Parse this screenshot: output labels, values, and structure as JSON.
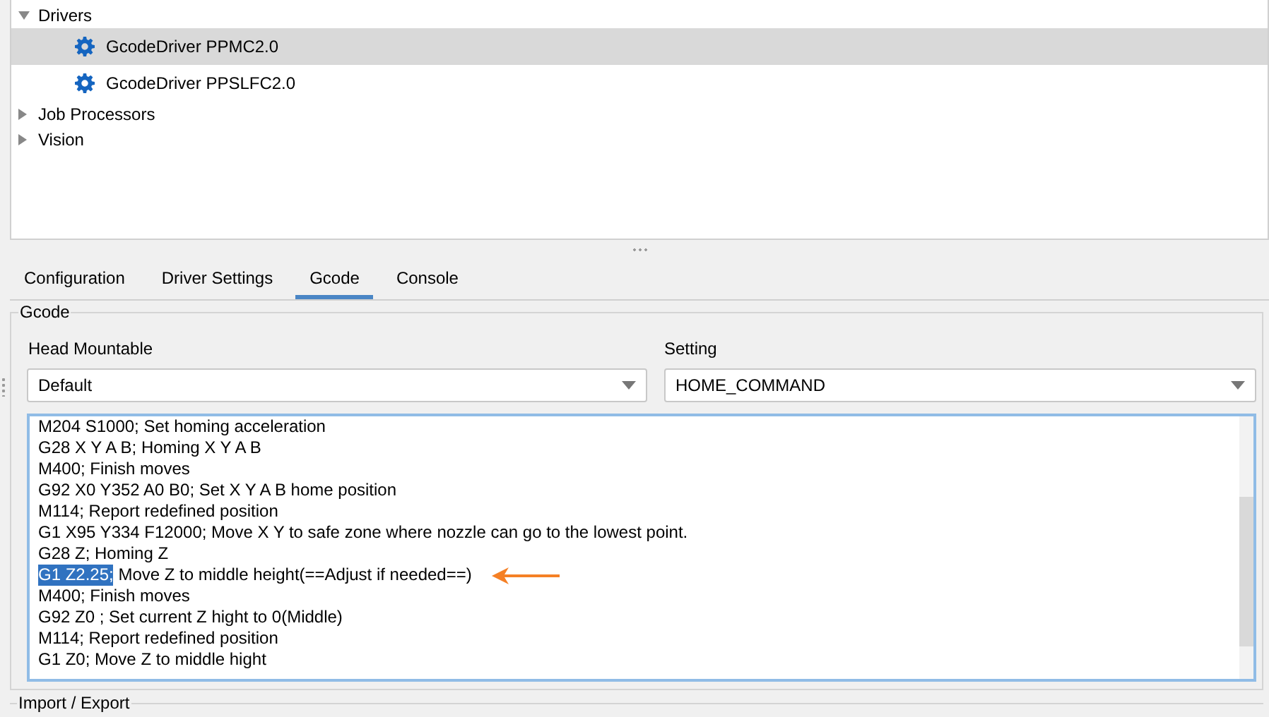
{
  "tree": [
    {
      "label": "Drivers",
      "expanded": true,
      "selected": false,
      "children": [
        {
          "label": "GcodeDriver PPMC2.0",
          "selected": true
        },
        {
          "label": "GcodeDriver PPSLFC2.0",
          "selected": false
        }
      ]
    },
    {
      "label": "Job Processors",
      "expanded": false,
      "selected": false
    },
    {
      "label": "Vision",
      "expanded": false,
      "selected": false
    }
  ],
  "tabs": [
    {
      "label": "Configuration",
      "selected": false
    },
    {
      "label": "Driver Settings",
      "selected": false
    },
    {
      "label": "Gcode",
      "selected": true
    },
    {
      "label": "Console",
      "selected": false
    }
  ],
  "gcode_group": {
    "title": "Gcode",
    "head_mountable": {
      "label": "Head Mountable",
      "value": "Default"
    },
    "setting": {
      "label": "Setting",
      "value": "HOME_COMMAND"
    },
    "lines": [
      {
        "segments": [
          {
            "text": "M204 S1000; Set homing acceleration",
            "selected": false
          }
        ]
      },
      {
        "segments": [
          {
            "text": "G28 X Y A B; Homing X Y A B",
            "selected": false
          }
        ]
      },
      {
        "segments": [
          {
            "text": "M400; Finish moves",
            "selected": false
          }
        ]
      },
      {
        "segments": [
          {
            "text": "G92 X0 Y352 A0 B0; Set X Y A B home position",
            "selected": false
          }
        ]
      },
      {
        "segments": [
          {
            "text": "M114; Report redefined position",
            "selected": false
          }
        ]
      },
      {
        "segments": [
          {
            "text": "G1 X95 Y334 F12000; Move X Y to safe zone where nozzle can go to the lowest point.",
            "selected": false
          }
        ]
      },
      {
        "segments": [
          {
            "text": "G28 Z; Homing Z",
            "selected": false
          }
        ]
      },
      {
        "segments": [
          {
            "text": "G1 Z2.25;",
            "selected": true
          },
          {
            "text": " Move Z to middle height(==Adjust if needed==)",
            "selected": false
          }
        ],
        "annotated": true
      },
      {
        "segments": [
          {
            "text": "M400; Finish moves",
            "selected": false
          }
        ]
      },
      {
        "segments": [
          {
            "text": "G92 Z0 ; Set current Z hight to 0(Middle)",
            "selected": false
          }
        ]
      },
      {
        "segments": [
          {
            "text": "M114; Report redefined position",
            "selected": false
          }
        ]
      },
      {
        "segments": [
          {
            "text": "G1 Z0; Move Z to middle hight",
            "selected": false
          }
        ]
      }
    ]
  },
  "import_export_group": {
    "title": "Import / Export"
  }
}
